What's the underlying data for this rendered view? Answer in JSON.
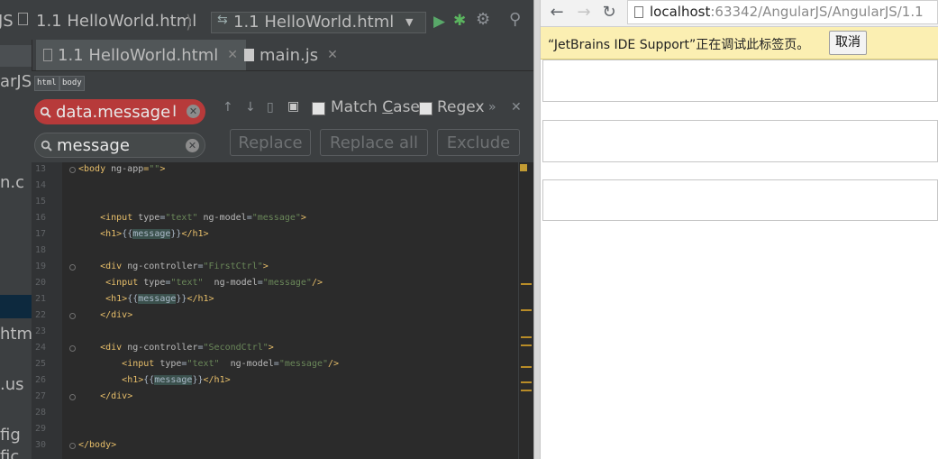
{
  "ide": {
    "nav_bar": {
      "project_fragment": "JS",
      "file_crumb": "1.1 HelloWorld.html",
      "run_config": "1.1 HelloWorld.html"
    },
    "tabs": [
      {
        "label": "1.1 HelloWorld.html",
        "active": true
      },
      {
        "label": "main.js",
        "active": false
      }
    ],
    "left_panel_fragments": [
      "arJS",
      "n.c",
      "htm",
      ".us",
      "fig",
      "fic"
    ],
    "breadcrumbs": [
      "html",
      "body"
    ],
    "find": {
      "search_value": "data.message",
      "replace_value": "message",
      "match_case_label_pre": "Match ",
      "match_case_label_u": "C",
      "match_case_label_post": "ase",
      "regex_label": "Regex",
      "replace_label": "Replace",
      "replace_all_label": "Replace all",
      "exclude_label": "Exclude"
    },
    "editor": {
      "line_numbers": [
        "13",
        "14",
        "15",
        "16",
        "17",
        "18",
        "19",
        "20",
        "21",
        "22",
        "23",
        "24",
        "25",
        "26",
        "27",
        "28",
        "29",
        "30"
      ],
      "lines": [
        {
          "n": "13",
          "parts": [
            [
              "tag",
              "<body "
            ],
            [
              "attr",
              "ng-app"
            ],
            [
              "tag",
              "="
            ],
            [
              "val",
              "\"\""
            ],
            [
              "tag",
              ">"
            ]
          ]
        },
        {
          "n": "14",
          "parts": []
        },
        {
          "n": "15",
          "parts": []
        },
        {
          "n": "16",
          "parts": [
            [
              "plain",
              "    "
            ],
            [
              "tag",
              "<input "
            ],
            [
              "attr",
              "type"
            ],
            [
              "plain",
              "="
            ],
            [
              "val",
              "\"text\""
            ],
            [
              "attr",
              " ng-model"
            ],
            [
              "plain",
              "="
            ],
            [
              "val",
              "\"message\""
            ],
            [
              "tag",
              ">"
            ]
          ]
        },
        {
          "n": "17",
          "parts": [
            [
              "plain",
              "    "
            ],
            [
              "tag",
              "<h1>"
            ],
            [
              "plain",
              "{{"
            ],
            [
              "hl",
              "message"
            ],
            [
              "plain",
              "}}"
            ],
            [
              "tag",
              "</h1>"
            ]
          ]
        },
        {
          "n": "18",
          "parts": []
        },
        {
          "n": "19",
          "parts": [
            [
              "plain",
              "    "
            ],
            [
              "tag",
              "<div "
            ],
            [
              "attr",
              "ng-controller"
            ],
            [
              "plain",
              "="
            ],
            [
              "val",
              "\"FirstCtrl\""
            ],
            [
              "tag",
              ">"
            ]
          ]
        },
        {
          "n": "20",
          "parts": [
            [
              "plain",
              "     "
            ],
            [
              "tag",
              "<input "
            ],
            [
              "attr",
              "type"
            ],
            [
              "plain",
              "="
            ],
            [
              "val",
              "\"text\""
            ],
            [
              "attr",
              "  ng-model"
            ],
            [
              "plain",
              "="
            ],
            [
              "val",
              "\"message\""
            ],
            [
              "tag",
              "/>"
            ]
          ]
        },
        {
          "n": "21",
          "parts": [
            [
              "plain",
              "     "
            ],
            [
              "tag",
              "<h1>"
            ],
            [
              "plain",
              "{{"
            ],
            [
              "hl",
              "message"
            ],
            [
              "plain",
              "}}"
            ],
            [
              "tag",
              "</h1>"
            ]
          ]
        },
        {
          "n": "22",
          "parts": [
            [
              "plain",
              "    "
            ],
            [
              "tag",
              "</div>"
            ]
          ]
        },
        {
          "n": "23",
          "parts": []
        },
        {
          "n": "24",
          "parts": [
            [
              "plain",
              "    "
            ],
            [
              "tag",
              "<div "
            ],
            [
              "attr",
              "ng-controller"
            ],
            [
              "plain",
              "="
            ],
            [
              "val",
              "\"SecondCtrl\""
            ],
            [
              "tag",
              ">"
            ]
          ]
        },
        {
          "n": "25",
          "parts": [
            [
              "plain",
              "        "
            ],
            [
              "tag",
              "<input "
            ],
            [
              "attr",
              "type"
            ],
            [
              "plain",
              "="
            ],
            [
              "val",
              "\"text\""
            ],
            [
              "attr",
              "  ng-model"
            ],
            [
              "plain",
              "="
            ],
            [
              "val",
              "\"message\""
            ],
            [
              "tag",
              "/>"
            ]
          ]
        },
        {
          "n": "26",
          "parts": [
            [
              "plain",
              "        "
            ],
            [
              "tag",
              "<h1>"
            ],
            [
              "plain",
              "{{"
            ],
            [
              "hl",
              "message"
            ],
            [
              "plain",
              "}}"
            ],
            [
              "tag",
              "</h1>"
            ]
          ]
        },
        {
          "n": "27",
          "parts": [
            [
              "plain",
              "    "
            ],
            [
              "tag",
              "</div>"
            ]
          ]
        },
        {
          "n": "28",
          "parts": []
        },
        {
          "n": "29",
          "parts": []
        },
        {
          "n": "30",
          "parts": [
            [
              "tag",
              "</body>"
            ]
          ]
        }
      ]
    },
    "colors": {
      "search_bg": "#b73a3a",
      "accent_mark": "#b88c28"
    }
  },
  "browser": {
    "url_host": "localhost",
    "url_rest": ":63342/AngularJS/AngularJS/1.1",
    "info_text": "“JetBrains IDE Support”正在调试此标签页。",
    "cancel_label": "取消"
  }
}
